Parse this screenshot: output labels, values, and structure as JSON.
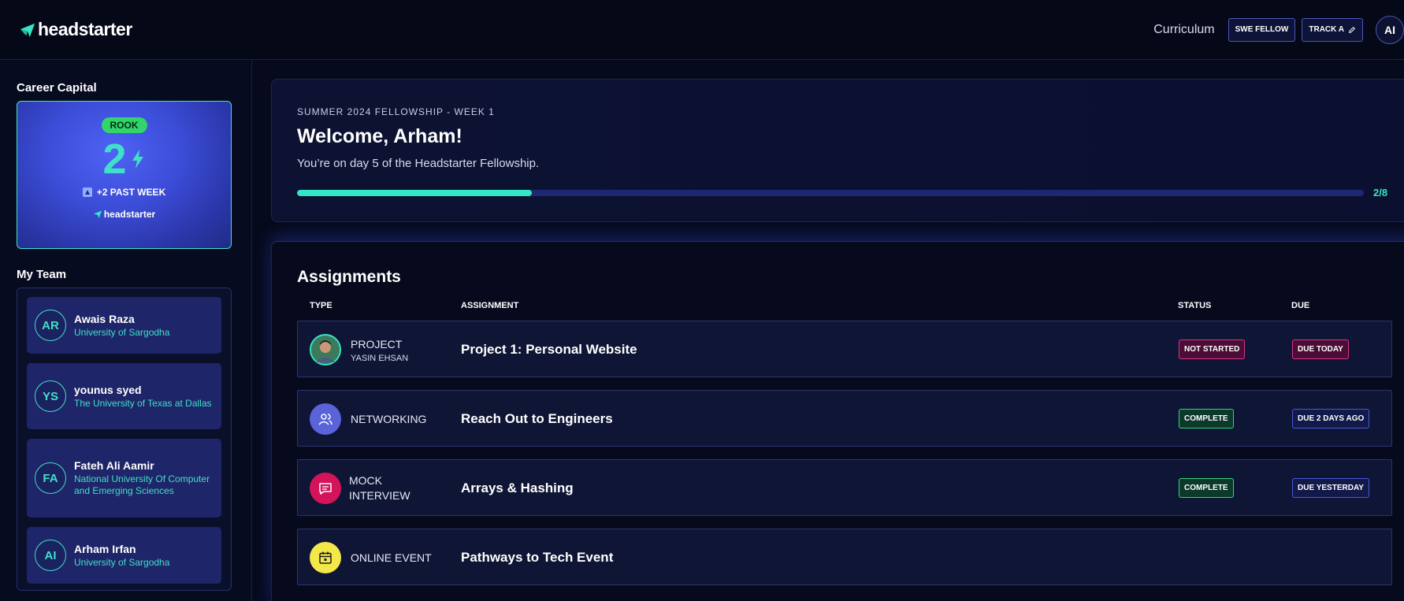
{
  "header": {
    "logo_text": "headstarter",
    "nav_curriculum": "Curriculum",
    "badge_fellow": "SWE FELLOW",
    "badge_track": "TRACK A",
    "user_initials": "AI"
  },
  "sidebar": {
    "career_capital_title": "Career Capital",
    "rank": "ROOK",
    "score": "2",
    "past_week": "+2 PAST WEEK",
    "card_logo": "headstarter",
    "team_title": "My Team",
    "team": [
      {
        "initials": "AR",
        "name": "Awais Raza",
        "university": "University of Sargodha"
      },
      {
        "initials": "YS",
        "name": "younus syed",
        "university": "The University of Texas at Dallas"
      },
      {
        "initials": "FA",
        "name": "Fateh Ali Aamir",
        "university": "National University Of Computer and Emerging Sciences"
      },
      {
        "initials": "AI",
        "name": "Arham Irfan",
        "university": "University of Sargodha"
      }
    ]
  },
  "welcome": {
    "program_label": "SUMMER 2024 FELLOWSHIP - WEEK 1",
    "title": "Welcome, Arham!",
    "subtitle": "You’re on day 5 of the Headstarter Fellowship.",
    "progress_text": "2/8",
    "progress_fraction": 0.22
  },
  "assignments": {
    "title": "Assignments",
    "columns": {
      "type": "TYPE",
      "assignment": "ASSIGNMENT",
      "status": "STATUS",
      "due": "DUE"
    },
    "rows": [
      {
        "type": "PROJECT",
        "type_sub": "YASIN EHSAN",
        "icon": "avatar-photo",
        "name": "Project 1: Personal Website",
        "status": "NOT STARTED",
        "due": "DUE TODAY"
      },
      {
        "type": "NETWORKING",
        "type_sub": "",
        "icon": "people-icon",
        "name": "Reach Out to Engineers",
        "status": "COMPLETE",
        "due": "DUE 2 DAYS AGO"
      },
      {
        "type": "MOCK INTERVIEW",
        "type_sub": "",
        "icon": "chat-icon",
        "name": "Arrays & Hashing",
        "status": "COMPLETE",
        "due": "DUE YESTERDAY"
      },
      {
        "type": "ONLINE EVENT",
        "type_sub": "",
        "icon": "calendar-icon",
        "name": "Pathways to Tech Event",
        "status": "",
        "due": ""
      }
    ]
  },
  "colors": {
    "accent_teal": "#35e6c4",
    "complete_green": "#35d27a",
    "alert_pink": "#e0338a",
    "card_blue": "#3c4dd8"
  }
}
